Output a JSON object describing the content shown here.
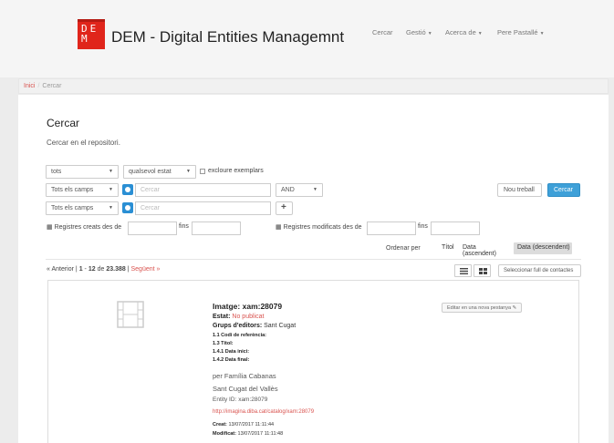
{
  "header": {
    "logo_letters": [
      "D",
      "E",
      "M"
    ],
    "app_title": "DEM - Digital Entities Managemnt",
    "nav": [
      {
        "label": "Cercar",
        "has_caret": false
      },
      {
        "label": "Gestió",
        "has_caret": true
      },
      {
        "label": "Acerca de",
        "has_caret": true
      },
      {
        "label": "Pere Pastallé",
        "has_caret": true
      }
    ]
  },
  "breadcrumb": {
    "home": "Inici",
    "separator": "/",
    "current": "Cercar"
  },
  "page": {
    "title": "Cercar",
    "subtitle": "Cercar en el repositori."
  },
  "filters": {
    "scope_select": "tots",
    "state_select": "qualsevol estat",
    "exclude_label": "excloure exemplars",
    "exclude_checked": false,
    "field1_select": "Tots els camps",
    "field1_placeholder": "Cercar",
    "operator_select": "AND",
    "field2_select": "Tots els camps",
    "field2_placeholder": "Cercar",
    "add_button": "+",
    "new_work_button": "Nou treball",
    "search_button": "Cercar",
    "created_from_label": "Registres creats des de",
    "created_to_label": "fins",
    "modified_from_label": "Registres modificats des de",
    "modified_to_label": "fins"
  },
  "ordering": {
    "label": "Ordenar per",
    "options": [
      "Títol",
      "Data (ascendent)",
      "Data (descendent)"
    ],
    "active": "Data (descendent)"
  },
  "pager": {
    "prev": "« Anterior",
    "sep": "|",
    "range_start": "1",
    "range_end": "12",
    "of": "de",
    "total": "23.388",
    "next": "Següent »"
  },
  "view_icons": [
    "list-view-icon",
    "grid-view-icon"
  ],
  "select_contacts_button": "Seleccionar full de contactes",
  "record": {
    "edit_button": "Editar en una nova pestanya",
    "image_label": "Imatge:",
    "image_id": "xam:28079",
    "state_label": "Estat:",
    "state_value": "No publicat",
    "groups_label": "Grups d'editors:",
    "groups_value": "Sant Cugat",
    "ref_code_label": "1.1 Codi de referència:",
    "title_label": "1.3 Títol:",
    "start_date_label": "1.4.1 Data inici:",
    "end_date_label": "1.4.2 Data final:",
    "author": "per Família Cabanas",
    "location": "Sant Cugat del Vallès",
    "entity_label": "Entity ID:",
    "entity_id": "xam:28079",
    "link": "http://imagina.diba.cat/catalog/xam:28079",
    "created_label": "Creat:",
    "created_value": "13/07/2017 11:11:44",
    "modified_label": "Modificat:",
    "modified_value": "13/07/2017 11:11:48"
  },
  "colors": {
    "brand_red": "#e0251b",
    "accent_blue": "#3ea0d8",
    "link_red": "#d9534f"
  }
}
